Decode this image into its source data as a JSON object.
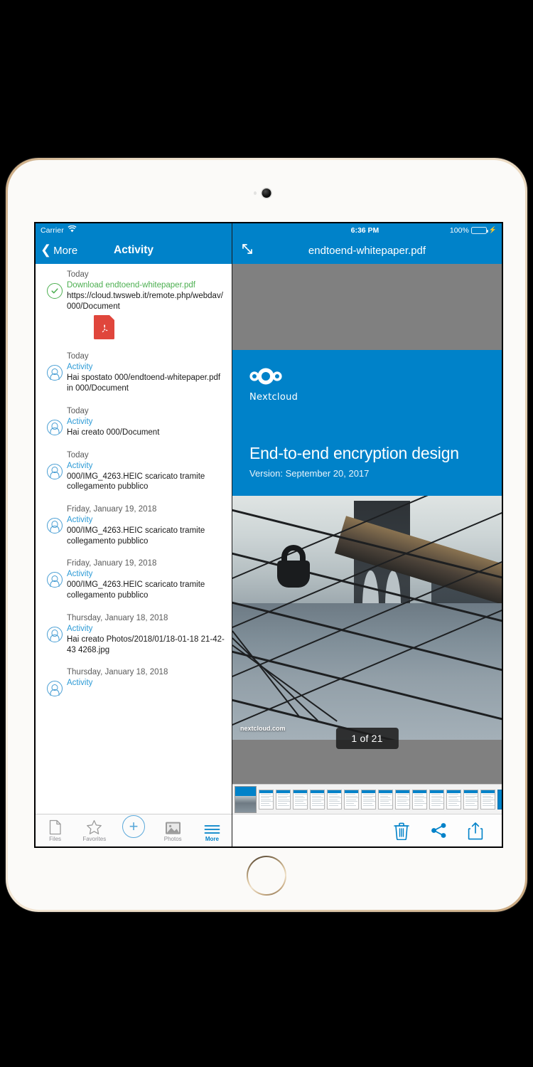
{
  "statusbar": {
    "carrier": "Carrier",
    "wifi_icon": "wifi-icon",
    "time": "6:36 PM",
    "battery_percent": "100%",
    "charging_icon": "lightning-bolt-icon"
  },
  "left_pane": {
    "navbar": {
      "back_label": "More",
      "back_icon": "chevron-left-icon",
      "title": "Activity"
    },
    "activities": [
      {
        "date": "Today",
        "subject": "Download endtoend-whitepaper.pdf",
        "subject_color": "#4caf50",
        "icon": "check-circle-icon",
        "message": "https://cloud.twsweb.it/remote.php/webdav/000/Document",
        "attachment_icon": "pdf-file-icon"
      },
      {
        "date": "Today",
        "subject": "Activity",
        "subject_color": "#2d9bd6",
        "icon": "user-avatar-icon",
        "message": "Hai spostato 000/endtoend-whitepaper.pdf in 000/Document"
      },
      {
        "date": "Today",
        "subject": "Activity",
        "subject_color": "#2d9bd6",
        "icon": "user-avatar-icon",
        "message": "Hai creato 000/Document"
      },
      {
        "date": "Today",
        "subject": "Activity",
        "subject_color": "#2d9bd6",
        "icon": "user-avatar-icon",
        "message": "000/IMG_4263.HEIC scaricato tramite collegamento pubblico"
      },
      {
        "date": "Friday, January 19, 2018",
        "subject": "Activity",
        "subject_color": "#2d9bd6",
        "icon": "user-avatar-icon",
        "message": "000/IMG_4263.HEIC scaricato tramite collegamento pubblico"
      },
      {
        "date": "Friday, January 19, 2018",
        "subject": "Activity",
        "subject_color": "#2d9bd6",
        "icon": "user-avatar-icon",
        "message": "000/IMG_4263.HEIC scaricato tramite collegamento pubblico"
      },
      {
        "date": "Thursday, January 18, 2018",
        "subject": "Activity",
        "subject_color": "#2d9bd6",
        "icon": "user-avatar-icon",
        "message": "Hai creato Photos/2018/01/18-01-18 21-42-43 4268.jpg"
      },
      {
        "date": "Thursday, January 18, 2018",
        "subject": "Activity",
        "subject_color": "#2d9bd6",
        "icon": "user-avatar-icon",
        "message": ""
      }
    ],
    "tabbar": [
      {
        "label": "Files",
        "icon": "document-icon",
        "active": false
      },
      {
        "label": "Favorites",
        "icon": "star-icon",
        "active": false
      },
      {
        "label": "",
        "icon": "plus-circle-icon",
        "active": false
      },
      {
        "label": "Photos",
        "icon": "photo-icon",
        "active": false
      },
      {
        "label": "More",
        "icon": "hamburger-menu-icon",
        "active": true
      }
    ]
  },
  "right_pane": {
    "navbar": {
      "expand_icon": "expand-arrows-icon",
      "title": "endtoend-whitepaper.pdf"
    },
    "document": {
      "brand": "Nextcloud",
      "brand_logo_icon": "nextcloud-logo-icon",
      "heading": "End-to-end encryption design",
      "version": "Version: September 20, 2017",
      "photo_watermark": "nextcloud.com",
      "photo_alt": "padlock-on-bridge-cable-photo"
    },
    "page_indicator": "1 of 21",
    "thumbnail_count": 16,
    "selected_thumbnail": 1,
    "toolbar": [
      {
        "icon": "trash-icon",
        "name": "delete-button"
      },
      {
        "icon": "share-icon",
        "name": "share-button"
      },
      {
        "icon": "export-icon",
        "name": "export-button"
      }
    ]
  },
  "colors": {
    "brand_blue": "#0082c9",
    "green": "#4caf50",
    "link_blue": "#2d9bd6",
    "pdf_red": "#e0463c",
    "viewer_gray": "#808080"
  }
}
